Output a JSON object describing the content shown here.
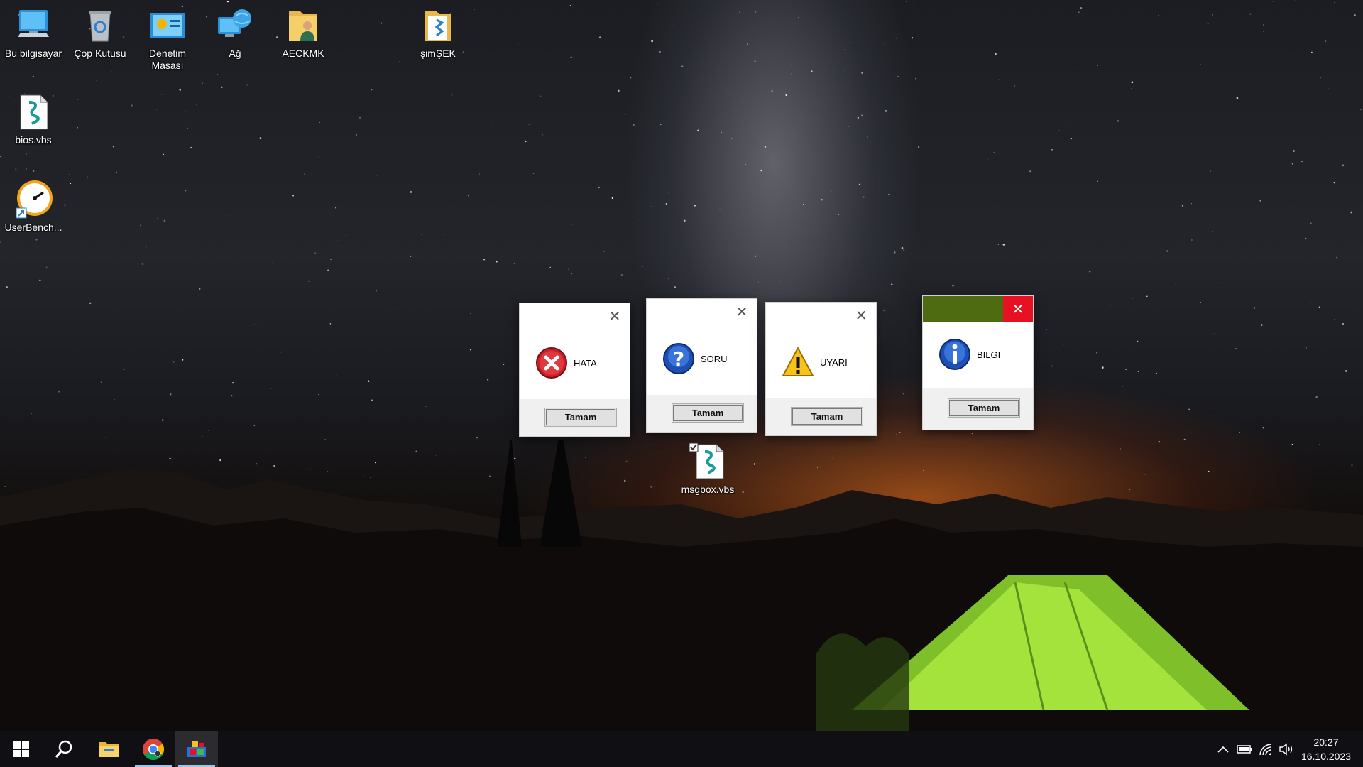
{
  "desktop": {
    "icons": [
      {
        "label": "Bu bilgisayar",
        "icon": "computer-icon"
      },
      {
        "label": "Çop Kutusu",
        "icon": "recycle-bin-icon"
      },
      {
        "label": "Denetim Masası",
        "icon": "control-panel-icon"
      },
      {
        "label": "Ağ",
        "icon": "network-icon"
      },
      {
        "label": "AECKMK",
        "icon": "user-folder-icon"
      },
      {
        "label": "şimŞEK",
        "icon": "folder-icon"
      },
      {
        "label": "bios.vbs",
        "icon": "script-file-icon"
      },
      {
        "label": "UserBench...",
        "icon": "speedometer-icon"
      },
      {
        "label": "msgbox.vbs",
        "icon": "script-file-icon"
      }
    ]
  },
  "dialogs": [
    {
      "message": "HATA",
      "icon": "error-icon",
      "button": "Tamam",
      "active": false
    },
    {
      "message": "SORU",
      "icon": "question-icon",
      "button": "Tamam",
      "active": false
    },
    {
      "message": "UYARI",
      "icon": "warning-icon",
      "button": "Tamam",
      "active": false
    },
    {
      "message": "BILGI",
      "icon": "info-icon",
      "button": "Tamam",
      "active": true,
      "accent": "#4e6b12"
    }
  ],
  "taskbar": {
    "items": [
      "windows-start-icon",
      "search-icon",
      "file-explorer-icon",
      "chrome-icon",
      "app-icon"
    ],
    "clock": {
      "time": "20:27",
      "date": "16.10.2023"
    },
    "tray": [
      "chevron-up-icon",
      "battery-icon",
      "wifi-icon",
      "speaker-icon"
    ]
  },
  "colors": {
    "close_red": "#e81123",
    "taskbar": "#101014",
    "running_indicator": "#9ec3e6"
  }
}
